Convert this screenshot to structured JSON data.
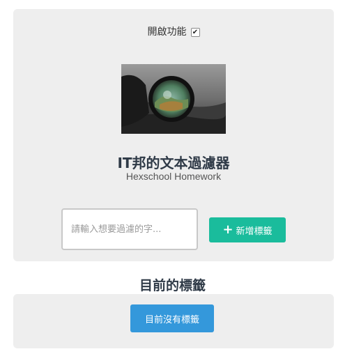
{
  "toggle": {
    "label": "開啟功能",
    "checked": true
  },
  "hero": {
    "image_icon": "lens-landscape-photo"
  },
  "app": {
    "title": "IT邦的文本過濾器",
    "subtitle": "Hexschool Homework"
  },
  "tag_form": {
    "placeholder": "請輸入想要過濾的字...",
    "value": "",
    "add_button_label": "新增標籤",
    "add_button_icon": "plus-icon"
  },
  "tags_section": {
    "heading": "目前的標籤",
    "empty_button_label": "目前沒有標籤"
  },
  "colors": {
    "panel_bg": "#eeeeee",
    "add_button": "#1abc9c",
    "empty_button": "#3498db",
    "heading_text": "#2f3a47"
  }
}
